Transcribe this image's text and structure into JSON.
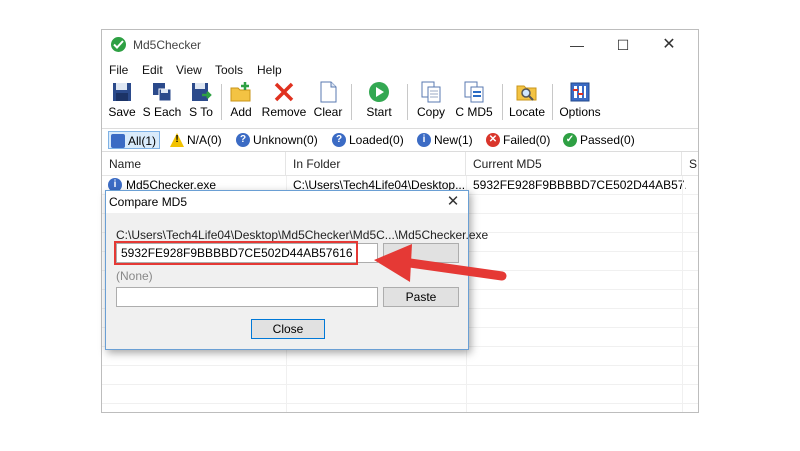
{
  "window": {
    "title": "Md5Checker",
    "minimize_glyph": "—",
    "maximize_glyph": "☐",
    "close_glyph": "✕"
  },
  "menu": [
    "File",
    "Edit",
    "View",
    "Tools",
    "Help"
  ],
  "toolbar": {
    "save": "Save",
    "save_each": "S Each",
    "save_to": "S To",
    "add": "Add",
    "remove": "Remove",
    "clear": "Clear",
    "start": "Start",
    "copy": "Copy",
    "copy_md5": "C MD5",
    "locate": "Locate",
    "options": "Options"
  },
  "filters": {
    "all": "All(1)",
    "na": "N/A(0)",
    "unknown": "Unknown(0)",
    "loaded": "Loaded(0)",
    "new": "New(1)",
    "failed": "Failed(0)",
    "passed": "Passed(0)"
  },
  "list": {
    "columns": [
      "Name",
      "In Folder",
      "Current MD5",
      "S"
    ],
    "rows": [
      {
        "name": "Md5Checker.exe",
        "folder": "C:\\Users\\Tech4Life04\\Desktop...",
        "md5": "5932FE928F9BBBBD7CE502D44AB57..."
      }
    ]
  },
  "dialog": {
    "title": "Compare MD5",
    "close_glyph": "✕",
    "path": "C:\\Users\\Tech4Life04\\Desktop\\Md5Checker\\Md5C...\\Md5Checker.exe",
    "md5_value": "5932FE928F9BBBBD7CE502D44AB57616",
    "none_label": "(None)",
    "compare_value": "",
    "copy_label": "",
    "paste_label": "Paste",
    "close_label": "Close"
  },
  "colors": {
    "accent": "#0078d7",
    "highlight": "#e53935",
    "check_green": "#2ea043"
  }
}
